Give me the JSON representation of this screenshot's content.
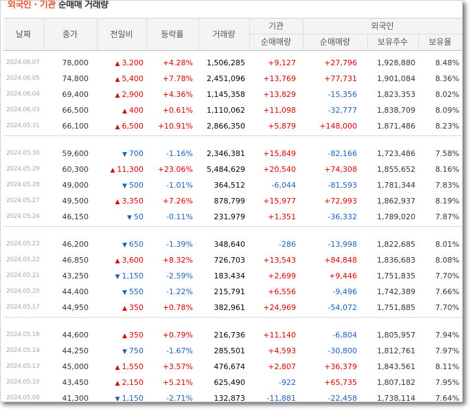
{
  "title": {
    "part1": "외국인 · 기관",
    "part2": "순매매 거래량"
  },
  "headers": {
    "date": "날짜",
    "close": "종가",
    "diff": "전일비",
    "rate": "등락률",
    "volume": "거래량",
    "institution": "기관",
    "foreign": "외국인",
    "inst_net": "순매매량",
    "foreign_net": "순매매량",
    "foreign_holding": "보유주수",
    "foreign_ratio": "보유율"
  },
  "colors": {
    "up": "#d80000",
    "down": "#1d5fc3",
    "title_accent": "#e4502d"
  },
  "groups": [
    [
      {
        "date": "2024.06.07",
        "close": "78,000",
        "dir": "up",
        "diff": "3,200",
        "rate": "+4.28%",
        "volume": "1,506,285",
        "inst": "+9,127",
        "fnet": "+27,796",
        "hold": "1,928,880",
        "ratio": "8.48%"
      },
      {
        "date": "2024.06.05",
        "close": "74,800",
        "dir": "up",
        "diff": "5,400",
        "rate": "+7.78%",
        "volume": "2,451,096",
        "inst": "+13,769",
        "fnet": "+77,731",
        "hold": "1,901,084",
        "ratio": "8.36%"
      },
      {
        "date": "2024.06.04",
        "close": "69,400",
        "dir": "up",
        "diff": "2,900",
        "rate": "+4.36%",
        "volume": "1,145,358",
        "inst": "+13,829",
        "fnet": "-15,356",
        "hold": "1,823,353",
        "ratio": "8.02%"
      },
      {
        "date": "2024.06.03",
        "close": "66,500",
        "dir": "up",
        "diff": "400",
        "rate": "+0.61%",
        "volume": "1,110,062",
        "inst": "+11,098",
        "fnet": "-32,777",
        "hold": "1,838,709",
        "ratio": "8.09%"
      },
      {
        "date": "2024.05.31",
        "close": "66,100",
        "dir": "up",
        "diff": "6,500",
        "rate": "+10.91%",
        "volume": "2,866,350",
        "inst": "+5,879",
        "fnet": "+148,000",
        "hold": "1,871,486",
        "ratio": "8.23%"
      }
    ],
    [
      {
        "date": "2024.05.30",
        "close": "59,600",
        "dir": "down",
        "diff": "700",
        "rate": "-1.16%",
        "volume": "2,346,381",
        "inst": "+15,849",
        "fnet": "-82,166",
        "hold": "1,723,486",
        "ratio": "7.58%"
      },
      {
        "date": "2024.05.29",
        "close": "60,300",
        "dir": "up",
        "diff": "11,300",
        "rate": "+23.06%",
        "volume": "5,484,629",
        "inst": "+20,540",
        "fnet": "+74,308",
        "hold": "1,855,652",
        "ratio": "8.16%"
      },
      {
        "date": "2024.05.28",
        "close": "49,000",
        "dir": "down",
        "diff": "500",
        "rate": "-1.01%",
        "volume": "364,512",
        "inst": "-6,044",
        "fnet": "-81,593",
        "hold": "1,781,344",
        "ratio": "7.83%"
      },
      {
        "date": "2024.05.27",
        "close": "49,500",
        "dir": "up",
        "diff": "3,350",
        "rate": "+7.26%",
        "volume": "878,799",
        "inst": "+15,977",
        "fnet": "+72,993",
        "hold": "1,862,937",
        "ratio": "8.19%"
      },
      {
        "date": "2024.05.24",
        "close": "46,150",
        "dir": "down",
        "diff": "50",
        "rate": "-0.11%",
        "volume": "231,979",
        "inst": "+1,351",
        "fnet": "-36,332",
        "hold": "1,789,020",
        "ratio": "7.87%"
      }
    ],
    [
      {
        "date": "2024.05.23",
        "close": "46,200",
        "dir": "down",
        "diff": "650",
        "rate": "-1.39%",
        "volume": "348,640",
        "inst": "-286",
        "fnet": "-13,998",
        "hold": "1,822,685",
        "ratio": "8.01%"
      },
      {
        "date": "2024.05.22",
        "close": "46,850",
        "dir": "up",
        "diff": "3,600",
        "rate": "+8.32%",
        "volume": "726,703",
        "inst": "+13,543",
        "fnet": "+84,848",
        "hold": "1,836,683",
        "ratio": "8.08%"
      },
      {
        "date": "2024.05.21",
        "close": "43,250",
        "dir": "down",
        "diff": "1,150",
        "rate": "-2.59%",
        "volume": "183,434",
        "inst": "+2,699",
        "fnet": "+9,446",
        "hold": "1,751,835",
        "ratio": "7.70%"
      },
      {
        "date": "2024.05.20",
        "close": "44,400",
        "dir": "down",
        "diff": "550",
        "rate": "-1.22%",
        "volume": "215,791",
        "inst": "+6,556",
        "fnet": "-9,496",
        "hold": "1,742,389",
        "ratio": "7.66%"
      },
      {
        "date": "2024.05.17",
        "close": "44,950",
        "dir": "up",
        "diff": "350",
        "rate": "+0.78%",
        "volume": "382,961",
        "inst": "+24,969",
        "fnet": "-54,072",
        "hold": "1,751,885",
        "ratio": "7.70%"
      }
    ],
    [
      {
        "date": "2024.05.16",
        "close": "44,600",
        "dir": "up",
        "diff": "350",
        "rate": "+0.79%",
        "volume": "216,736",
        "inst": "+11,140",
        "fnet": "-6,804",
        "hold": "1,805,957",
        "ratio": "7.94%"
      },
      {
        "date": "2024.05.14",
        "close": "44,250",
        "dir": "down",
        "diff": "750",
        "rate": "-1.67%",
        "volume": "285,501",
        "inst": "+4,593",
        "fnet": "-30,800",
        "hold": "1,812,761",
        "ratio": "7.97%"
      },
      {
        "date": "2024.05.13",
        "close": "45,000",
        "dir": "up",
        "diff": "1,550",
        "rate": "+3.57%",
        "volume": "476,674",
        "inst": "+2,807",
        "fnet": "+36,379",
        "hold": "1,843,561",
        "ratio": "8.11%"
      },
      {
        "date": "2024.05.10",
        "close": "43,450",
        "dir": "up",
        "diff": "2,150",
        "rate": "+5.21%",
        "volume": "625,490",
        "inst": "-922",
        "fnet": "+65,735",
        "hold": "1,807,182",
        "ratio": "7.95%"
      },
      {
        "date": "2024.05.09",
        "close": "41,300",
        "dir": "down",
        "diff": "1,150",
        "rate": "-2.71%",
        "volume": "132,873",
        "inst": "-11,881",
        "fnet": "-22,458",
        "hold": "1,738,114",
        "ratio": "7.64%"
      }
    ]
  ]
}
